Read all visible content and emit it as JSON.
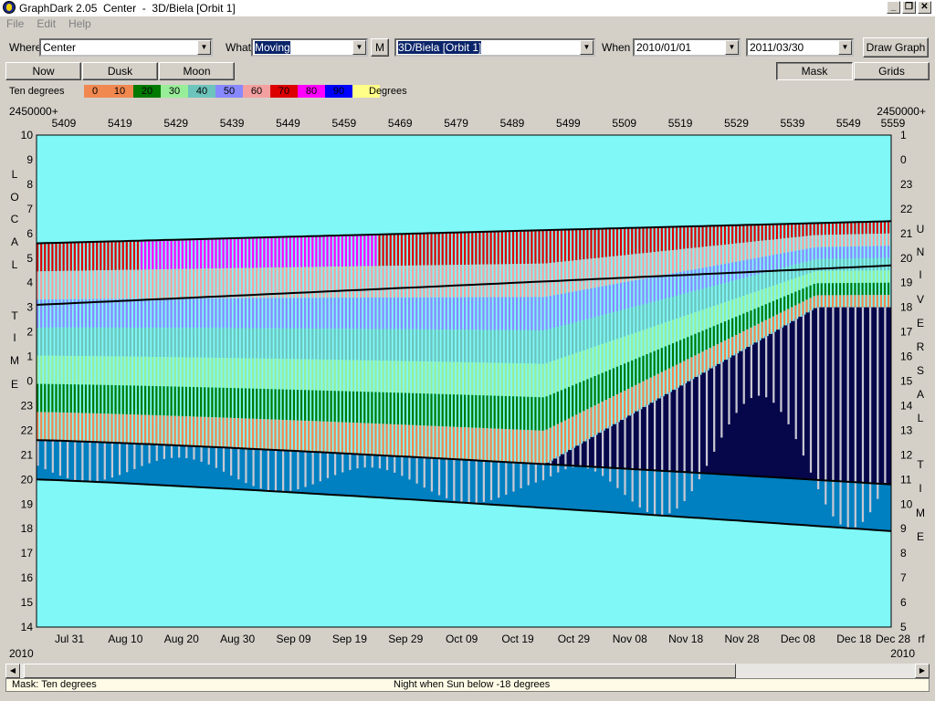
{
  "window": {
    "title": "GraphDark 2.05  Center  -  3D/Biela [Orbit 1]"
  },
  "menu": [
    "File",
    "Edit",
    "Help"
  ],
  "controls": {
    "where_label": "Where",
    "where_value": "Center",
    "what_label": "What",
    "what_value": "Moving",
    "m_button": "M",
    "object_value": "3D/Biela [Orbit 1]",
    "when_label": "When",
    "start_date": "2010/01/01",
    "end_date": "2011/03/30",
    "draw_button": "Draw Graph"
  },
  "buttons": {
    "now": "Now",
    "dusk": "Dusk",
    "moon": "Moon",
    "mask": "Mask",
    "grids": "Grids"
  },
  "legend": {
    "label": "Ten degrees",
    "unit": "Degrees",
    "items": [
      {
        "label": "0",
        "color": "#f08850"
      },
      {
        "label": "10",
        "color": "#f08850"
      },
      {
        "label": "20",
        "color": "#007a00"
      },
      {
        "label": "30",
        "color": "#98ee98"
      },
      {
        "label": "40",
        "color": "#6cc4bc"
      },
      {
        "label": "50",
        "color": "#8888ff"
      },
      {
        "label": "60",
        "color": "#f4a0a0"
      },
      {
        "label": "70",
        "color": "#dd0000"
      },
      {
        "label": "80",
        "color": "#ff00ff"
      },
      {
        "label": "90",
        "color": "#0000ff"
      },
      {
        "label": "",
        "color": "#ffff88"
      }
    ]
  },
  "chart_data": {
    "type": "heatmap",
    "jd_prefix": "2450000+",
    "top_axis": [
      "5409",
      "5419",
      "5429",
      "5439",
      "5449",
      "5459",
      "5469",
      "5479",
      "5489",
      "5499",
      "5509",
      "5519",
      "5529",
      "5539",
      "5549",
      "5559"
    ],
    "bottom_axis": [
      "Jul 31",
      "Aug 10",
      "Aug 20",
      "Aug 30",
      "Sep 09",
      "Sep 19",
      "Sep 29",
      "Oct 09",
      "Oct 19",
      "Oct 29",
      "Nov 08",
      "Nov 18",
      "Nov 28",
      "Dec 08",
      "Dec 18",
      "Dec 28"
    ],
    "bottom_year_left": "2010",
    "bottom_year_right": "2010",
    "bottom_right_extra": "rf",
    "left_axis": [
      "10",
      "9",
      "8",
      "7",
      "6",
      "5",
      "4",
      "3",
      "2",
      "1",
      "0",
      "23",
      "22",
      "21",
      "20",
      "19",
      "18",
      "17",
      "16",
      "15",
      "14"
    ],
    "right_axis": [
      "1",
      "0",
      "23",
      "22",
      "21",
      "20",
      "19",
      "18",
      "17",
      "16",
      "15",
      "14",
      "13",
      "12",
      "11",
      "10",
      "9",
      "8",
      "7",
      "6",
      "5"
    ],
    "left_title": "LOCAL TIME",
    "right_title": "UNIVERSAL TIME",
    "colors": {
      "background": "#80f8f8",
      "night": "#06064a",
      "twilight": "#0080c0",
      "nodata": "#c8c8d4"
    }
  },
  "status": {
    "mask": "Mask:  Ten degrees",
    "night": "Night when Sun below -18 degrees"
  }
}
